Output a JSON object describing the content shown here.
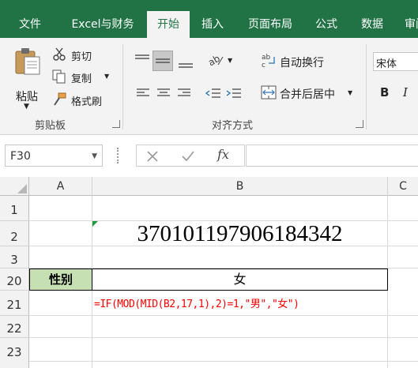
{
  "tabs": [
    "文件",
    "Excel与财务",
    "开始",
    "插入",
    "页面布局",
    "公式",
    "数据",
    "审阅"
  ],
  "clipboard": {
    "paste": "粘贴",
    "cut": "剪切",
    "copy": "复制",
    "format_painter": "格式刷",
    "group": "剪贴板"
  },
  "alignment": {
    "wrap_text": "自动换行",
    "merge_center": "合并后居中",
    "group": "对齐方式"
  },
  "font": {
    "name": "宋体",
    "bold": "B",
    "italic": "I"
  },
  "formula_bar": {
    "cell_ref": "F30",
    "fx": "fx",
    "content": ""
  },
  "columns": [
    "A",
    "B",
    "C"
  ],
  "rows": [
    "1",
    "2",
    "3",
    "20",
    "21",
    "22",
    "23"
  ],
  "cells": {
    "B2": "370101197906184342",
    "A20": "性别",
    "B20": "女",
    "B21": "=IF(MOD(MID(B2,17,1),2)=1,\"男\",\"女\")"
  },
  "colors": {
    "ribbon_green": "#217346",
    "header_fill": "#c6e0b4",
    "formula_text": "#ff0000"
  }
}
